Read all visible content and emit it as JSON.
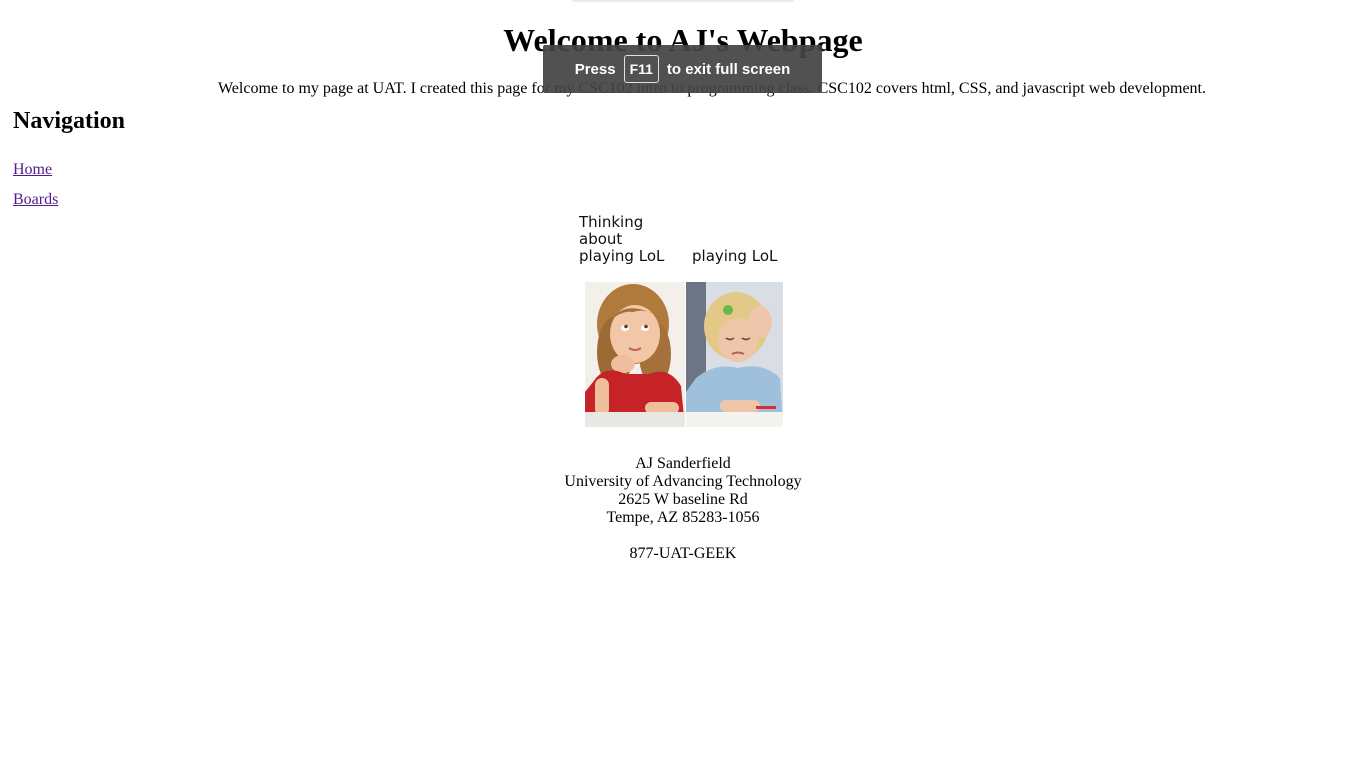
{
  "header": {
    "title": "Welcome to AJ's Webpage",
    "intro": "Welcome to my page at UAT. I created this page for my CSC102 intro to programming class. CSC102 covers html, CSS, and javascript web development."
  },
  "navigation": {
    "heading": "Navigation",
    "links": [
      {
        "label": "Home"
      },
      {
        "label": "Boards"
      }
    ]
  },
  "meme": {
    "left_caption": "Thinking\nabout\nplaying LoL",
    "right_caption": "playing LoL"
  },
  "contact": {
    "name": "AJ Sanderfield",
    "organization": "University of Advancing Technology",
    "street": "2625 W baseline Rd",
    "city": "Tempe, AZ 85283-1056",
    "phone": "877-UAT-GEEK"
  },
  "fullscreen_toast": {
    "prefix": "Press",
    "key": "F11",
    "suffix": "to exit full screen"
  }
}
